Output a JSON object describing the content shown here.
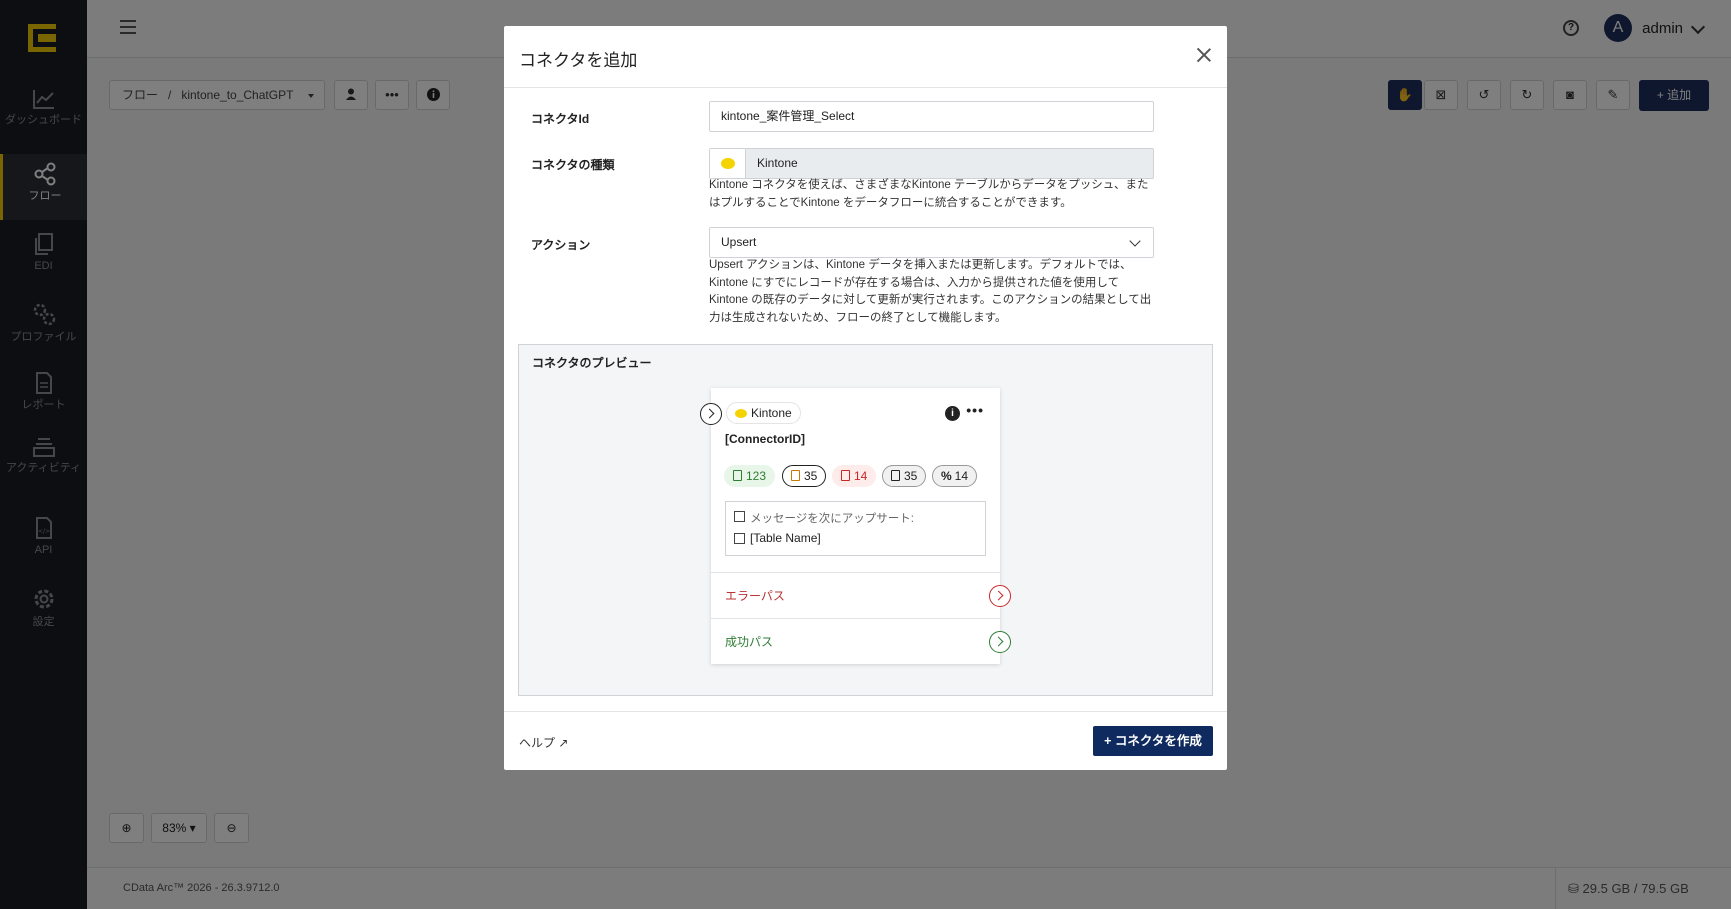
{
  "app": {
    "nav": [
      {
        "label": "ダッシュボード",
        "icon": "chart-icon"
      },
      {
        "label": "フロー",
        "icon": "share-nodes-icon",
        "active": true
      },
      {
        "label": "EDI",
        "icon": "documents-icon"
      },
      {
        "label": "プロファイル",
        "icon": "gears-icon"
      },
      {
        "label": "レポート",
        "icon": "report-icon"
      },
      {
        "label": "アクティビティ",
        "icon": "layers-icon"
      },
      {
        "label": "API",
        "icon": "api-file-icon"
      },
      {
        "label": "設定",
        "icon": "gear-icon"
      }
    ],
    "user": {
      "initial": "A",
      "name": "admin"
    },
    "breadcrumb": "フロー   /   kintone_to_ChatGPT",
    "toolbar": {
      "add_label": "+ 追加"
    },
    "zoom": {
      "value": "83%"
    },
    "footer": {
      "version": "CData Arc™ 2026 - 26.3.9712.0",
      "disk": "29.5 GB / 79.5 GB"
    }
  },
  "modal": {
    "title": "コネクタを追加",
    "connector_id": {
      "label": "コネクタId",
      "value": "kintone_案件管理_Select"
    },
    "connector_type": {
      "label": "コネクタの種類",
      "value": "Kintone",
      "description": "Kintone コネクタを使えば、さまざまなKintone テーブルからデータをプッシュ、またはプルすることでKintone をデータフローに統合することができます。"
    },
    "action": {
      "label": "アクション",
      "value": "Upsert",
      "description": "Upsert アクションは、Kintone データを挿入または更新します。デフォルトでは、Kintone にすでにレコードが存在する場合は、入力から提供された値を使用してKintone の既存のデータに対して更新が実行されます。このアクションの結果として出力は生成されないため、フローの終了として機能します。"
    },
    "preview": {
      "label": "コネクタのプレビュー",
      "chip": "Kintone",
      "connector_id": "[ConnectorID]",
      "badges": [
        "123",
        "35",
        "14",
        "35",
        "14"
      ],
      "message_line": "メッセージを次にアップサート:",
      "table_line": "[Table Name]",
      "error_path": "エラーパス",
      "success_path": "成功パス"
    },
    "help_label": "ヘルプ",
    "create_label": "+ コネクタを作成"
  }
}
